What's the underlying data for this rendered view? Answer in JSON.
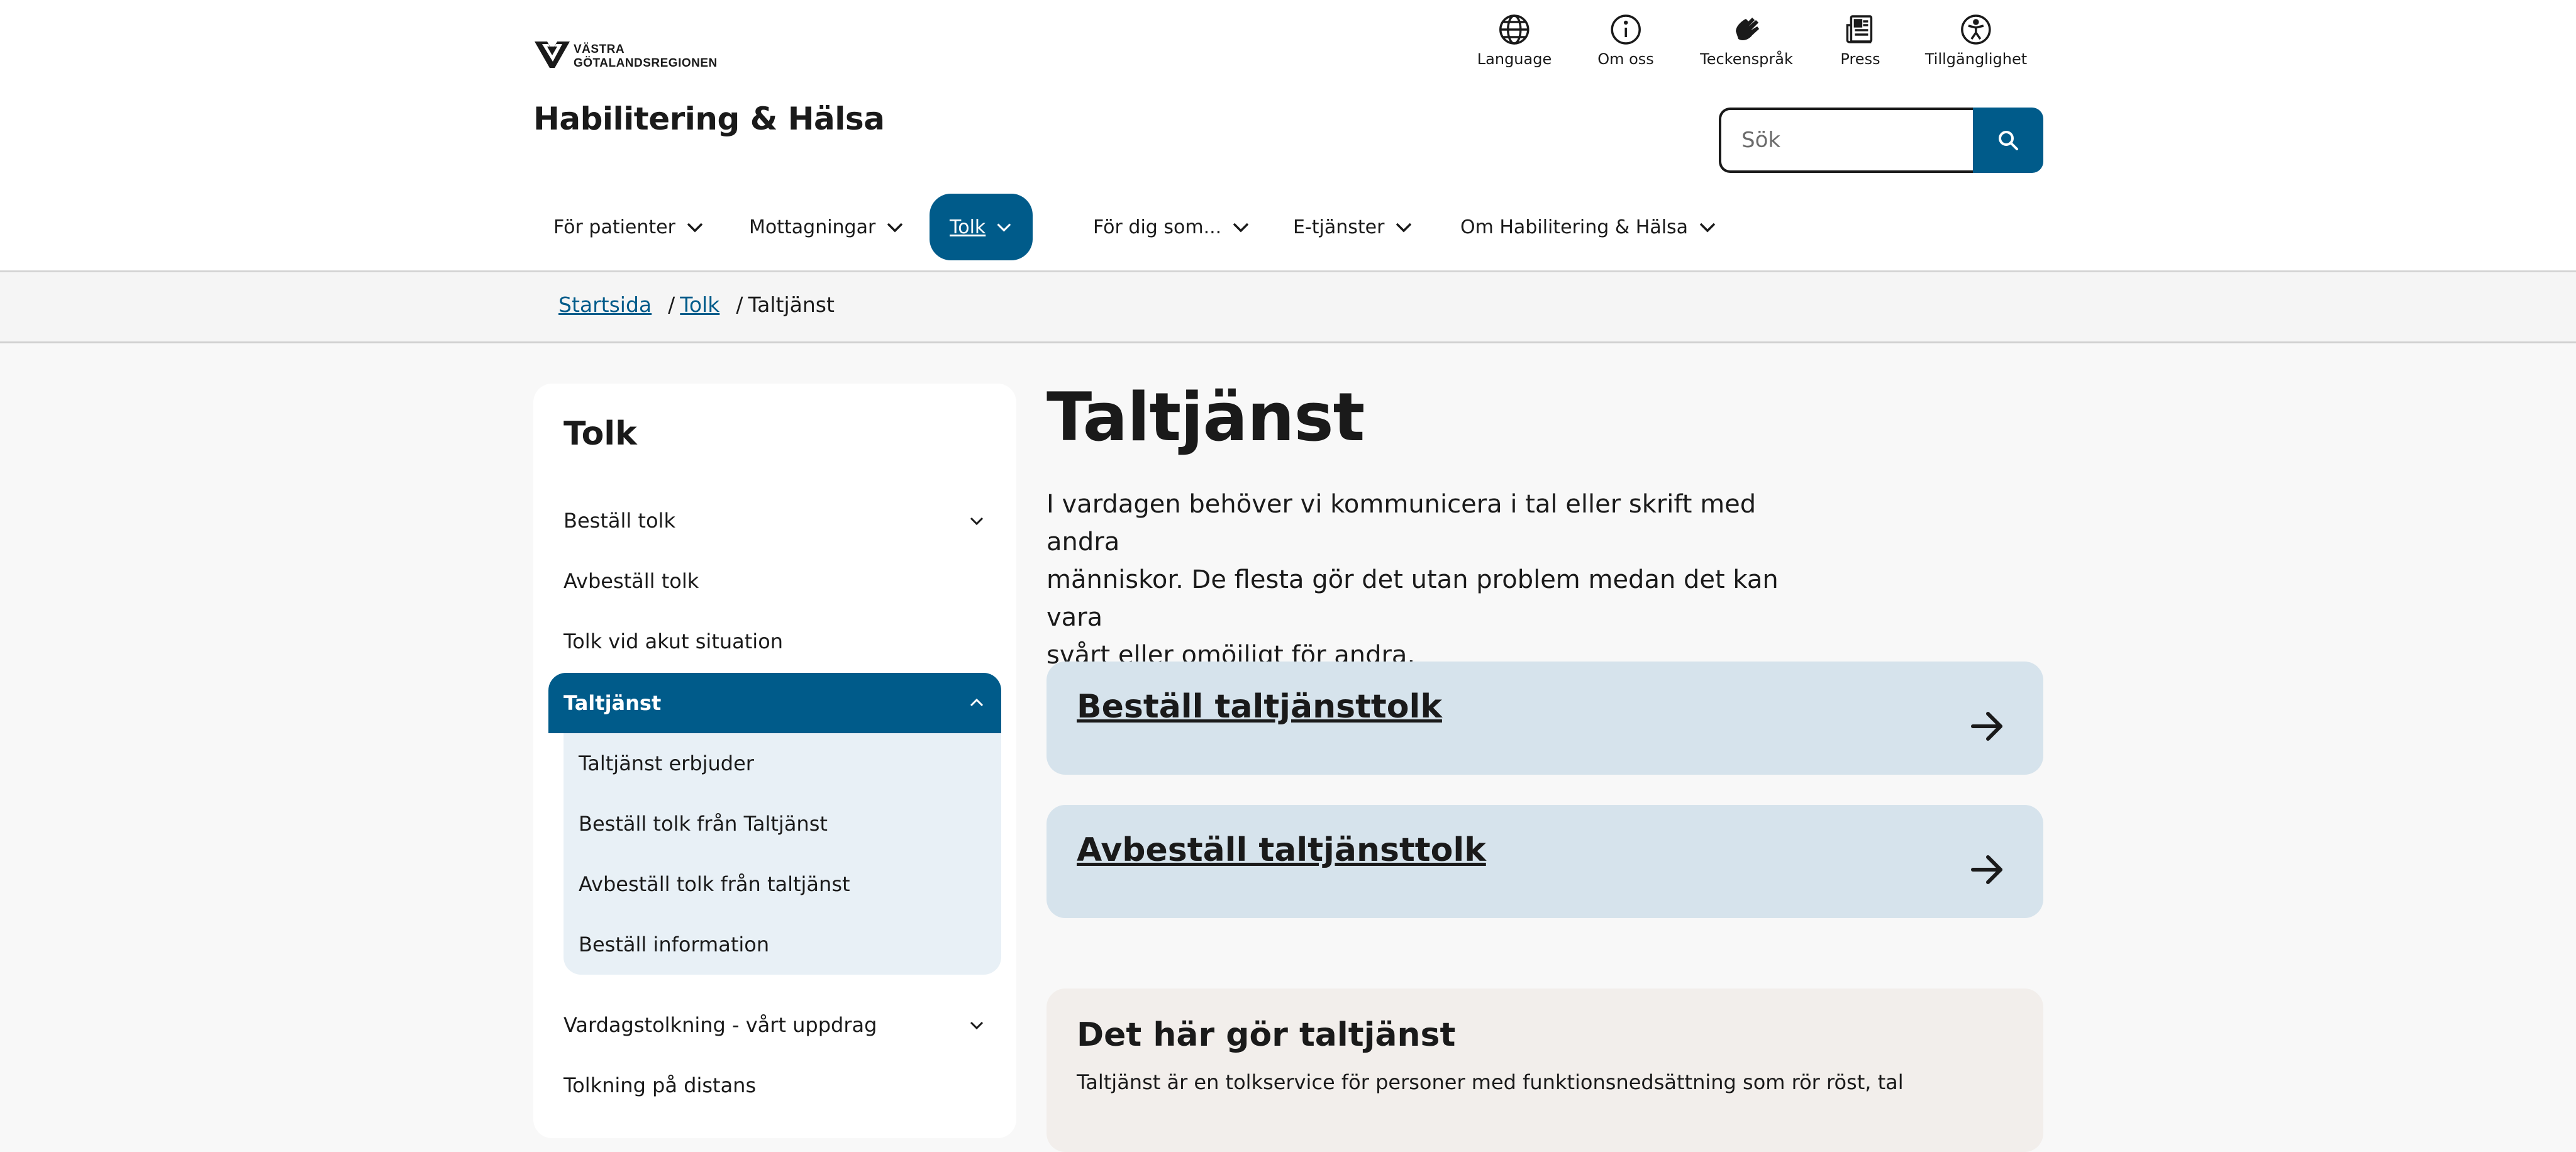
{
  "brand": {
    "logo_lines": [
      "VÄSTRA",
      "GÖTALANDSREGIONEN"
    ],
    "site_title": "Habilitering & Hälsa",
    "accent_color": "#005b8a"
  },
  "utility_nav": [
    {
      "label": "Language",
      "icon": "globe-icon"
    },
    {
      "label": "Om oss",
      "icon": "info-icon"
    },
    {
      "label": "Teckenspråk",
      "icon": "sign-language-icon"
    },
    {
      "label": "Press",
      "icon": "newspaper-icon"
    },
    {
      "label": "Tillgänglighet",
      "icon": "accessibility-icon"
    }
  ],
  "search": {
    "placeholder": "Sök",
    "button_icon": "search-icon"
  },
  "main_nav": [
    {
      "label": "För patienter"
    },
    {
      "label": "Mottagningar"
    },
    {
      "label": "Tolk",
      "active": true
    },
    {
      "label": "För dig som..."
    },
    {
      "label": "E-tjänster"
    },
    {
      "label": "Om Habilitering & Hälsa"
    }
  ],
  "breadcrumb": {
    "items": [
      {
        "label": "Startsida"
      },
      {
        "label": "Tolk"
      }
    ],
    "separator": "/",
    "current": "Taltjänst"
  },
  "sidebar": {
    "title": "Tolk",
    "items": [
      {
        "label": "Beställ tolk",
        "expandable": true
      },
      {
        "label": "Avbeställ tolk"
      },
      {
        "label": "Tolk vid akut situation"
      },
      {
        "label": "Taltjänst",
        "expandable": true,
        "expanded": true,
        "active": true
      },
      {
        "label": "Vardagstolkning - vårt uppdrag",
        "expandable": true
      },
      {
        "label": "Tolkning på distans"
      }
    ],
    "sub_items": [
      {
        "label": "Taltjänst erbjuder"
      },
      {
        "label": "Beställ tolk från Taltjänst"
      },
      {
        "label": "Avbeställ tolk från taltjänst"
      },
      {
        "label": "Beställ information"
      }
    ]
  },
  "main": {
    "heading": "Taltjänst",
    "lead_lines": [
      "I vardagen behöver vi kommunicera i tal eller skrift med andra",
      "människor. De flesta gör det utan problem medan det kan vara",
      "svårt eller omöjligt för andra."
    ],
    "cta_cards": [
      {
        "title": "Beställ taltjänsttolk",
        "icon": "arrow-right-icon"
      },
      {
        "title": "Avbeställ taltjänsttolk",
        "icon": "arrow-right-icon"
      }
    ],
    "info_card": {
      "title": "Det här gör taltjänst",
      "text": "Taltjänst är en tolkservice för personer med funktionsnedsättning som rör röst, tal"
    }
  }
}
